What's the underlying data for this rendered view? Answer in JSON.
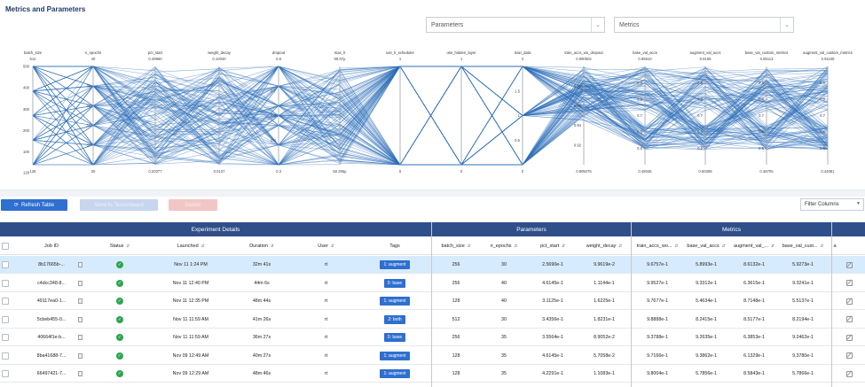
{
  "page_title": "Metrics and Parameters",
  "selects": {
    "parameters": "Parameters",
    "metrics": "Metrics"
  },
  "chart_data": {
    "type": "parallel_coordinates",
    "line_color": "#2e6fba",
    "left_axis_ticks": [
      "500",
      "400",
      "300",
      "200",
      "100",
      "128"
    ],
    "axes": [
      {
        "name": "batch_size",
        "top": "512",
        "bottom": "128"
      },
      {
        "name": "n_epochs",
        "top": "40",
        "bottom": "30"
      },
      {
        "name": "pct_start",
        "top": "0.49960",
        "bottom": "0.20377"
      },
      {
        "name": "weight_decay",
        "top": "0.10040",
        "bottom": "0.0137"
      },
      {
        "name": "dropout",
        "top": "0.8",
        "bottom": "0.3"
      },
      {
        "name": "max_lr",
        "top": "99.97μ",
        "bottom": "50.296μ"
      },
      {
        "name": "use_lr_scheduler",
        "top": "1",
        "bottom": "0"
      },
      {
        "name": "use_hidden_layer",
        "top": "1",
        "bottom": "0"
      },
      {
        "name": "train_data",
        "top": "2",
        "bottom": "0"
      },
      {
        "name": "train_accs_wo_dropout",
        "top": "0.990502",
        "bottom": "0.909375"
      },
      {
        "name": "base_val_accs",
        "top": "0.95610",
        "bottom": "0.48046"
      },
      {
        "name": "augment_val_accs",
        "top": "0.9159",
        "bottom": "0.50308"
      },
      {
        "name": "base_val_custom_metrics",
        "top": "0.95113",
        "bottom": "0.48705"
      },
      {
        "name": "augment_val_custom_metrics",
        "top": "0.91108",
        "bottom": "0.44081"
      }
    ],
    "inner_ticks": {
      "n_epochs": [
        "38",
        "36",
        "34",
        "32"
      ],
      "dropout": [
        "0.7",
        "0.6",
        "0.4"
      ],
      "train_data": [
        "1.5",
        "1",
        "0.5"
      ],
      "train_accs_wo_dropout": [
        "0.98",
        "0.96",
        "0.94",
        "0.92"
      ],
      "base_val_accs": [
        "0.9",
        "0.8",
        "0.7",
        "0.6",
        "0.5"
      ],
      "augment_val_accs": [
        "0.9",
        "0.8",
        "0.7",
        "0.6",
        "0.5"
      ],
      "base_val_custom_metrics": [
        "0.9",
        "0.8",
        "0.7",
        "0.6",
        "0.5"
      ],
      "augment_val_custom_metrics": [
        "0.9",
        "0.8",
        "0.7",
        "0.6",
        "0.5"
      ]
    }
  },
  "toolbar": {
    "refresh_label": "Refresh Table",
    "tensorboard_label": "Send to Tensorboard",
    "delete_label": "Delete",
    "filter_label": "Filter Columns"
  },
  "table": {
    "groups": {
      "experiment": "Experiment Details",
      "parameters": "Parameters",
      "metrics": "Metrics"
    },
    "columns": {
      "job_id": "Job ID",
      "status": "Status",
      "launched": "Launched",
      "duration": "Duration",
      "user": "User",
      "tags": "Tags",
      "batch_size": "batch_size",
      "n_epochs": "n_epochs",
      "pct_start": "pct_start",
      "weight_decay": "weight_decay",
      "train_accs": "train_accs_wo...",
      "base_val_accs": "base_val_accs",
      "augment_val": "augment_val_...",
      "base_val_cust": "base_val_cust...",
      "extra": "a"
    },
    "rows": [
      {
        "job_id": "8b17665b-...",
        "launched": "Nov 11 1:24 PM",
        "duration": "32m 41s",
        "user": "rt",
        "tag": "1: augment",
        "batch_size": "256",
        "n_epochs": "30",
        "pct_start": "2.5690e-1",
        "weight_decay": "9.9619e-2",
        "train_accs": "9.6757e-1",
        "base_val_accs": "5.8993e-1",
        "augment_val": "8.6132e-1",
        "base_val_cust": "5.9273e-1",
        "selected": true
      },
      {
        "job_id": "c4dcc348-8...",
        "launched": "Nov 11 12:40 PM",
        "duration": "44m 6s",
        "user": "rt",
        "tag": "0: base",
        "batch_size": "256",
        "n_epochs": "40",
        "pct_start": "4.6145e-1",
        "weight_decay": "1.1144e-1",
        "train_accs": "9.9527e-1",
        "base_val_accs": "9.3312e-1",
        "augment_val": "6.3615e-1",
        "base_val_cust": "9.3241e-1"
      },
      {
        "job_id": "49117ea0-1...",
        "launched": "Nov 11 12:35 PM",
        "duration": "48m 44s",
        "user": "rt",
        "tag": "1: augment",
        "batch_size": "128",
        "n_epochs": "40",
        "pct_start": "3.1125e-1",
        "weight_decay": "1.6225e-1",
        "train_accs": "9.7677e-1",
        "base_val_accs": "5.4634e-1",
        "augment_val": "8.7148e-1",
        "base_val_cust": "5.5137e-1"
      },
      {
        "job_id": "5cbeb455-0...",
        "launched": "Nov 11 11:59 AM",
        "duration": "41m 26s",
        "user": "rt",
        "tag": "2: both",
        "batch_size": "512",
        "n_epochs": "30",
        "pct_start": "3.4356e-1",
        "weight_decay": "1.8231e-1",
        "train_accs": "9.8888e-1",
        "base_val_accs": "8.2415e-1",
        "augment_val": "8.5177e-1",
        "base_val_cust": "8.2194e-1"
      },
      {
        "job_id": "40664f1e-b...",
        "launched": "Nov 11 11:59 AM",
        "duration": "36m 27s",
        "user": "rt",
        "tag": "0: base",
        "batch_size": "256",
        "n_epochs": "35",
        "pct_start": "3.5564e-1",
        "weight_decay": "8.9052e-2",
        "train_accs": "9.3788e-1",
        "base_val_accs": "9.2635e-1",
        "augment_val": "6.3853e-1",
        "base_val_cust": "9.2462e-1"
      },
      {
        "job_id": "8ba41688-7...",
        "launched": "Nov 09 12:49 AM",
        "duration": "40m 27s",
        "user": "rt",
        "tag": "1: augment",
        "batch_size": "128",
        "n_epochs": "35",
        "pct_start": "4.6145e-1",
        "weight_decay": "5.7058e-2",
        "train_accs": "9.7166e-1",
        "base_val_accs": "9.3862e-1",
        "augment_val": "6.1329e-1",
        "base_val_cust": "9.3780e-1"
      },
      {
        "job_id": "66497421-7...",
        "launched": "Nov 09 12:29 AM",
        "duration": "48m 46s",
        "user": "rt",
        "tag": "1: augment",
        "batch_size": "128",
        "n_epochs": "35",
        "pct_start": "4.2291e-1",
        "weight_decay": "1.1083e-1",
        "train_accs": "9.8004e-1",
        "base_val_accs": "5.7856e-1",
        "augment_val": "8.5843e-1",
        "base_val_cust": "5.7866e-1"
      }
    ]
  }
}
